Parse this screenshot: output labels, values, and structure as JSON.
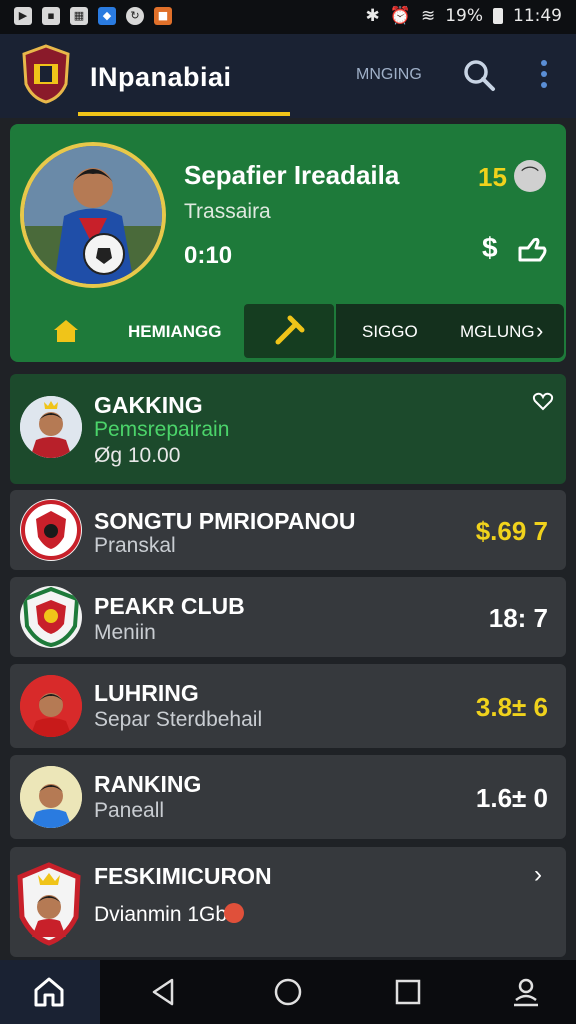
{
  "status_bar": {
    "battery": "19%",
    "time": "11:49"
  },
  "app_bar": {
    "title": "INpanabiai",
    "tab_label": "MNGING"
  },
  "featured": {
    "name": "Sepafier Ireadaila",
    "subtitle": "Trassaira",
    "time": "0:10",
    "score": "15",
    "dollar": "$",
    "nav": {
      "label_1": "HEMIANGG",
      "label_2": "SIGGO",
      "label_3": "MGLUNG"
    }
  },
  "cards": [
    {
      "title": "GAKKING",
      "subtitle": "Pemsrepairain",
      "extra": "Øg 10.00"
    },
    {
      "title": "SONGTU PMRIOPANOU",
      "subtitle": "Pranskal",
      "score": "$.69 7"
    },
    {
      "title": "PEAKR CLUB",
      "subtitle": "Meniin",
      "score": "18: 7"
    },
    {
      "title": "LUHRING",
      "subtitle": "Separ Sterdbehail",
      "score": "3.8± 6"
    },
    {
      "title": "RANKING",
      "subtitle": "Paneall",
      "score": "1.6± 0"
    },
    {
      "title": "FESKIMICURON",
      "subtitle": "Dvianmin 1Gb"
    }
  ],
  "colors": {
    "accent": "#f0c419",
    "featured_bg": "#1e7a3a",
    "score_yellow": "#f0d21c"
  }
}
